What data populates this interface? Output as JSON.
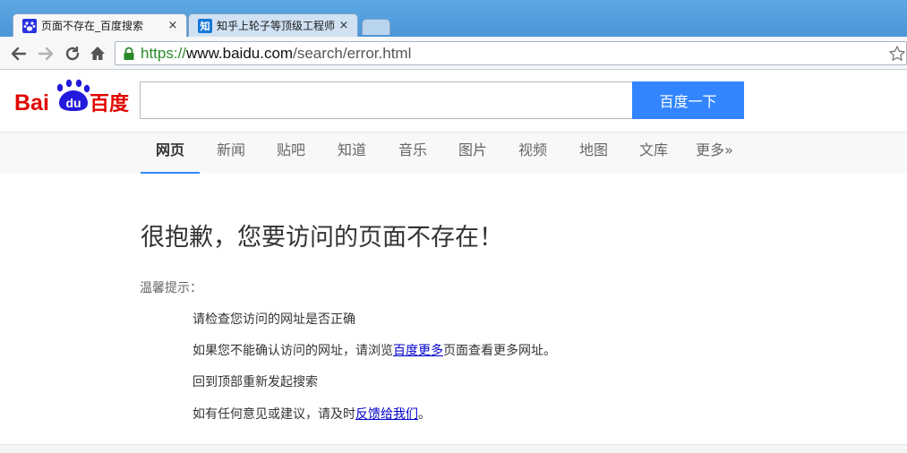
{
  "browser": {
    "tabs": [
      {
        "title": "页面不存在_百度搜索",
        "close": "×",
        "favicon": "paw-icon"
      },
      {
        "title": "知乎上轮子等顶级工程师",
        "close": "×",
        "favicon_text": "知"
      }
    ],
    "url": {
      "scheme": "https://",
      "host": "www.baidu.com",
      "path": "/search/error.html"
    }
  },
  "header": {
    "logo": {
      "left": "Bai",
      "middle": "du",
      "right": "百度"
    },
    "search_value": "",
    "search_button": "百度一下"
  },
  "nav": {
    "items": [
      "网页",
      "新闻",
      "贴吧",
      "知道",
      "音乐",
      "图片",
      "视频",
      "地图",
      "文库",
      "更多»"
    ],
    "active": "网页"
  },
  "content": {
    "title": "很抱歉，您要访问的页面不存在！",
    "tip_label": "温馨提示：",
    "tip1": "请检查您访问的网址是否正确",
    "tip2_pre": "如果您不能确认访问的网址，请浏览",
    "tip2_link": "百度更多",
    "tip2_post": "页面查看更多网址。",
    "tip3": "回到顶部重新发起搜索",
    "tip4_pre": "如有任何意见或建议，请及时",
    "tip4_link": "反馈给我们",
    "tip4_post": "。"
  },
  "colors": {
    "accent": "#3385ff",
    "link": "#0000cc",
    "logo_red": "#e10601",
    "logo_blue": "#2319dc"
  }
}
